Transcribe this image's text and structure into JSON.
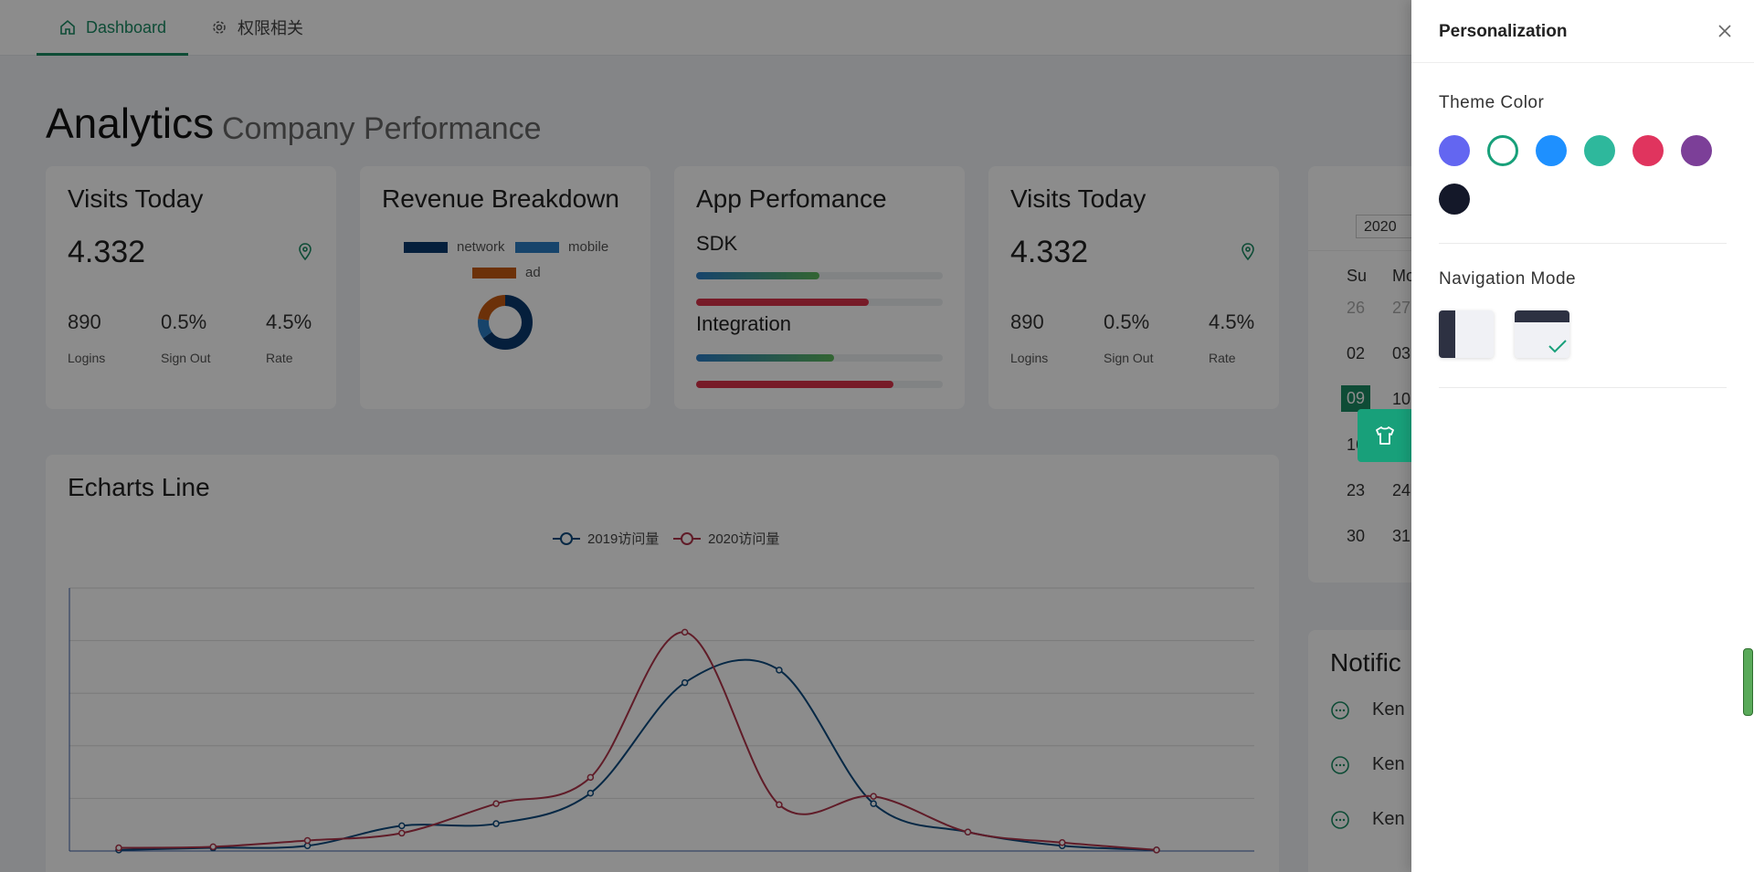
{
  "tabs": [
    {
      "label": "Dashboard",
      "icon": "home-icon",
      "active": true
    },
    {
      "label": "权限相关",
      "icon": "gear-icon",
      "active": false
    }
  ],
  "page": {
    "title": "Analytics",
    "subtitle": "Company Performance"
  },
  "visits_card": {
    "title": "Visits Today",
    "value": "4.332",
    "icon": "location-pin-icon",
    "stats": [
      {
        "value": "890",
        "label": "Logins"
      },
      {
        "value": "0.5%",
        "label": "Sign Out"
      },
      {
        "value": "4.5%",
        "label": "Rate"
      }
    ]
  },
  "revenue_card": {
    "title": "Revenue Breakdown",
    "legend": [
      {
        "name": "network",
        "color": "#0a3a6e"
      },
      {
        "name": "mobile",
        "color": "#2b7cc4"
      },
      {
        "name": "ad",
        "color": "#c55a11"
      }
    ]
  },
  "perf_card": {
    "title": "App Perfomance",
    "sections": [
      {
        "label": "SDK",
        "bars": [
          0.5,
          0.7
        ]
      },
      {
        "label": "Integration",
        "bars": [
          0.56,
          0.8
        ]
      }
    ]
  },
  "calendar": {
    "year": "2020",
    "headers": [
      "Su",
      "Mo"
    ],
    "rows": [
      [
        "26",
        "27"
      ],
      [
        "02",
        "03"
      ],
      [
        "09",
        "10"
      ],
      [
        "16",
        ""
      ],
      [
        "23",
        "24"
      ],
      [
        "30",
        "31"
      ]
    ],
    "selected": "09"
  },
  "line_card": {
    "title": "Echarts Line"
  },
  "notifications": {
    "title": "Notific",
    "items": [
      "Ken",
      "Ken",
      "Ken"
    ]
  },
  "chart_data": {
    "type": "line",
    "title": "Echarts Line",
    "series": [
      {
        "name": "2019访问量",
        "color": "#0b4a7e",
        "values": [
          1,
          3,
          5,
          24,
          26,
          55,
          160,
          172,
          45,
          18,
          5,
          1
        ]
      },
      {
        "name": "2020访问量",
        "color": "#b0334a",
        "values": [
          3,
          4,
          10,
          17,
          45,
          70,
          208,
          44,
          52,
          18,
          8,
          1
        ]
      }
    ],
    "ylim": [
      0,
      250
    ],
    "grid": true,
    "legend": "top-center"
  },
  "drawer": {
    "title": "Personalization",
    "theme_label": "Theme Color",
    "theme_colors": [
      "#6366f1",
      "#ffffff",
      "#1e90ff",
      "#2eb89c",
      "#e0345e",
      "#7c3f98",
      "#141829"
    ],
    "selected_theme": 1,
    "nav_label": "Navigation Mode",
    "nav_modes": [
      "sidebar",
      "top"
    ],
    "selected_nav": 1
  }
}
